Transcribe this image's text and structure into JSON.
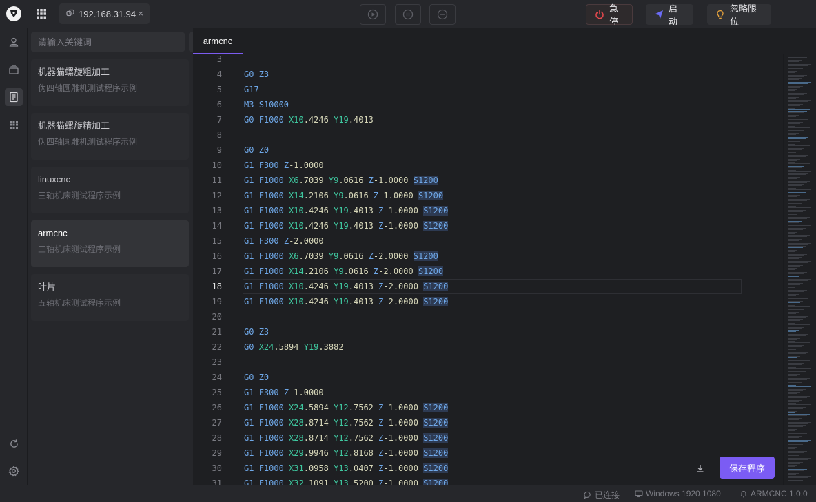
{
  "topbar": {
    "host": "192.168.31.94",
    "close_glyph": "×",
    "estop_label": "急停",
    "start_label": "启动",
    "ignore_limits_label": "忽略限位",
    "colors": {
      "estop": "#e5484d",
      "start": "#6b6cf6",
      "ignore": "#e8a33c"
    }
  },
  "sidebar": {
    "search_placeholder": "请输入关键词",
    "add_glyph": "+",
    "files": [
      {
        "name": "机器猫螺旋粗加工",
        "desc": "伪四轴圆雕机测试程序示例"
      },
      {
        "name": "机器猫螺旋精加工",
        "desc": "伪四轴圆雕机测试程序示例"
      },
      {
        "name": "linuxcnc",
        "desc": "三轴机床测试程序示例"
      },
      {
        "name": "armcnc",
        "desc": "三轴机床测试程序示例"
      },
      {
        "name": "叶片",
        "desc": "五轴机床测试程序示例"
      }
    ],
    "active_index": 3
  },
  "editor": {
    "tab": "armcnc",
    "current_line": "18",
    "save_label": "保存程序",
    "lines": [
      {
        "n": "3",
        "t": []
      },
      {
        "n": "4",
        "t": [
          [
            "g",
            "G0"
          ],
          [
            "sp",
            " "
          ],
          [
            "z",
            "Z3"
          ]
        ]
      },
      {
        "n": "5",
        "t": [
          [
            "g",
            "G17"
          ]
        ]
      },
      {
        "n": "6",
        "t": [
          [
            "g",
            "M3"
          ],
          [
            "sp",
            " "
          ],
          [
            "f",
            "S10000"
          ]
        ]
      },
      {
        "n": "7",
        "t": [
          [
            "g",
            "G0"
          ],
          [
            "sp",
            " "
          ],
          [
            "f",
            "F1000"
          ],
          [
            "sp",
            " "
          ],
          [
            "x",
            "X10"
          ],
          [
            "n",
            ".4246"
          ],
          [
            "sp",
            " "
          ],
          [
            "y",
            "Y19"
          ],
          [
            "n",
            ".4013"
          ]
        ]
      },
      {
        "n": "8",
        "t": []
      },
      {
        "n": "9",
        "t": [
          [
            "g",
            "G0"
          ],
          [
            "sp",
            " "
          ],
          [
            "z",
            "Z0"
          ]
        ]
      },
      {
        "n": "10",
        "t": [
          [
            "g",
            "G1"
          ],
          [
            "sp",
            " "
          ],
          [
            "f",
            "F300"
          ],
          [
            "sp",
            " "
          ],
          [
            "z",
            "Z"
          ],
          [
            "n",
            "-1.0000"
          ]
        ]
      },
      {
        "n": "11",
        "t": [
          [
            "g",
            "G1"
          ],
          [
            "sp",
            " "
          ],
          [
            "f",
            "F1000"
          ],
          [
            "sp",
            " "
          ],
          [
            "x",
            "X6"
          ],
          [
            "n",
            ".7039"
          ],
          [
            "sp",
            " "
          ],
          [
            "y",
            "Y9"
          ],
          [
            "n",
            ".0616"
          ],
          [
            "sp",
            " "
          ],
          [
            "z",
            "Z"
          ],
          [
            "n",
            "-1.0000"
          ],
          [
            "sp",
            " "
          ],
          [
            "s",
            "S1200"
          ]
        ]
      },
      {
        "n": "12",
        "t": [
          [
            "g",
            "G1"
          ],
          [
            "sp",
            " "
          ],
          [
            "f",
            "F1000"
          ],
          [
            "sp",
            " "
          ],
          [
            "x",
            "X14"
          ],
          [
            "n",
            ".2106"
          ],
          [
            "sp",
            " "
          ],
          [
            "y",
            "Y9"
          ],
          [
            "n",
            ".0616"
          ],
          [
            "sp",
            " "
          ],
          [
            "z",
            "Z"
          ],
          [
            "n",
            "-1.0000"
          ],
          [
            "sp",
            " "
          ],
          [
            "s",
            "S1200"
          ]
        ]
      },
      {
        "n": "13",
        "t": [
          [
            "g",
            "G1"
          ],
          [
            "sp",
            " "
          ],
          [
            "f",
            "F1000"
          ],
          [
            "sp",
            " "
          ],
          [
            "x",
            "X10"
          ],
          [
            "n",
            ".4246"
          ],
          [
            "sp",
            " "
          ],
          [
            "y",
            "Y19"
          ],
          [
            "n",
            ".4013"
          ],
          [
            "sp",
            " "
          ],
          [
            "z",
            "Z"
          ],
          [
            "n",
            "-1.0000"
          ],
          [
            "sp",
            " "
          ],
          [
            "s",
            "S1200"
          ]
        ]
      },
      {
        "n": "14",
        "t": [
          [
            "g",
            "G1"
          ],
          [
            "sp",
            " "
          ],
          [
            "f",
            "F1000"
          ],
          [
            "sp",
            " "
          ],
          [
            "x",
            "X10"
          ],
          [
            "n",
            ".4246"
          ],
          [
            "sp",
            " "
          ],
          [
            "y",
            "Y19"
          ],
          [
            "n",
            ".4013"
          ],
          [
            "sp",
            " "
          ],
          [
            "z",
            "Z"
          ],
          [
            "n",
            "-1.0000"
          ],
          [
            "sp",
            " "
          ],
          [
            "s",
            "S1200"
          ]
        ]
      },
      {
        "n": "15",
        "t": [
          [
            "g",
            "G1"
          ],
          [
            "sp",
            " "
          ],
          [
            "f",
            "F300"
          ],
          [
            "sp",
            " "
          ],
          [
            "z",
            "Z"
          ],
          [
            "n",
            "-2.0000"
          ]
        ]
      },
      {
        "n": "16",
        "t": [
          [
            "g",
            "G1"
          ],
          [
            "sp",
            " "
          ],
          [
            "f",
            "F1000"
          ],
          [
            "sp",
            " "
          ],
          [
            "x",
            "X6"
          ],
          [
            "n",
            ".7039"
          ],
          [
            "sp",
            " "
          ],
          [
            "y",
            "Y9"
          ],
          [
            "n",
            ".0616"
          ],
          [
            "sp",
            " "
          ],
          [
            "z",
            "Z"
          ],
          [
            "n",
            "-2.0000"
          ],
          [
            "sp",
            " "
          ],
          [
            "s",
            "S1200"
          ]
        ]
      },
      {
        "n": "17",
        "t": [
          [
            "g",
            "G1"
          ],
          [
            "sp",
            " "
          ],
          [
            "f",
            "F1000"
          ],
          [
            "sp",
            " "
          ],
          [
            "x",
            "X14"
          ],
          [
            "n",
            ".2106"
          ],
          [
            "sp",
            " "
          ],
          [
            "y",
            "Y9"
          ],
          [
            "n",
            ".0616"
          ],
          [
            "sp",
            " "
          ],
          [
            "z",
            "Z"
          ],
          [
            "n",
            "-2.0000"
          ],
          [
            "sp",
            " "
          ],
          [
            "s",
            "S1200"
          ]
        ]
      },
      {
        "n": "18",
        "t": [
          [
            "g",
            "G1"
          ],
          [
            "sp",
            " "
          ],
          [
            "f",
            "F1000"
          ],
          [
            "sp",
            " "
          ],
          [
            "x",
            "X10"
          ],
          [
            "n",
            ".4246"
          ],
          [
            "sp",
            " "
          ],
          [
            "y",
            "Y19"
          ],
          [
            "n",
            ".4013"
          ],
          [
            "sp",
            " "
          ],
          [
            "z",
            "Z"
          ],
          [
            "n",
            "-2.0000"
          ],
          [
            "sp",
            " "
          ],
          [
            "s",
            "S1200"
          ]
        ]
      },
      {
        "n": "19",
        "t": [
          [
            "g",
            "G1"
          ],
          [
            "sp",
            " "
          ],
          [
            "f",
            "F1000"
          ],
          [
            "sp",
            " "
          ],
          [
            "x",
            "X10"
          ],
          [
            "n",
            ".4246"
          ],
          [
            "sp",
            " "
          ],
          [
            "y",
            "Y19"
          ],
          [
            "n",
            ".4013"
          ],
          [
            "sp",
            " "
          ],
          [
            "z",
            "Z"
          ],
          [
            "n",
            "-2.0000"
          ],
          [
            "sp",
            " "
          ],
          [
            "s",
            "S1200"
          ]
        ]
      },
      {
        "n": "20",
        "t": []
      },
      {
        "n": "21",
        "t": [
          [
            "g",
            "G0"
          ],
          [
            "sp",
            " "
          ],
          [
            "z",
            "Z3"
          ]
        ]
      },
      {
        "n": "22",
        "t": [
          [
            "g",
            "G0"
          ],
          [
            "sp",
            " "
          ],
          [
            "x",
            "X24"
          ],
          [
            "n",
            ".5894"
          ],
          [
            "sp",
            " "
          ],
          [
            "y",
            "Y19"
          ],
          [
            "n",
            ".3882"
          ]
        ]
      },
      {
        "n": "23",
        "t": []
      },
      {
        "n": "24",
        "t": [
          [
            "g",
            "G0"
          ],
          [
            "sp",
            " "
          ],
          [
            "z",
            "Z0"
          ]
        ]
      },
      {
        "n": "25",
        "t": [
          [
            "g",
            "G1"
          ],
          [
            "sp",
            " "
          ],
          [
            "f",
            "F300"
          ],
          [
            "sp",
            " "
          ],
          [
            "z",
            "Z"
          ],
          [
            "n",
            "-1.0000"
          ]
        ]
      },
      {
        "n": "26",
        "t": [
          [
            "g",
            "G1"
          ],
          [
            "sp",
            " "
          ],
          [
            "f",
            "F1000"
          ],
          [
            "sp",
            " "
          ],
          [
            "x",
            "X24"
          ],
          [
            "n",
            ".5894"
          ],
          [
            "sp",
            " "
          ],
          [
            "y",
            "Y12"
          ],
          [
            "n",
            ".7562"
          ],
          [
            "sp",
            " "
          ],
          [
            "z",
            "Z"
          ],
          [
            "n",
            "-1.0000"
          ],
          [
            "sp",
            " "
          ],
          [
            "s",
            "S1200"
          ]
        ]
      },
      {
        "n": "27",
        "t": [
          [
            "g",
            "G1"
          ],
          [
            "sp",
            " "
          ],
          [
            "f",
            "F1000"
          ],
          [
            "sp",
            " "
          ],
          [
            "x",
            "X28"
          ],
          [
            "n",
            ".8714"
          ],
          [
            "sp",
            " "
          ],
          [
            "y",
            "Y12"
          ],
          [
            "n",
            ".7562"
          ],
          [
            "sp",
            " "
          ],
          [
            "z",
            "Z"
          ],
          [
            "n",
            "-1.0000"
          ],
          [
            "sp",
            " "
          ],
          [
            "s",
            "S1200"
          ]
        ]
      },
      {
        "n": "28",
        "t": [
          [
            "g",
            "G1"
          ],
          [
            "sp",
            " "
          ],
          [
            "f",
            "F1000"
          ],
          [
            "sp",
            " "
          ],
          [
            "x",
            "X28"
          ],
          [
            "n",
            ".8714"
          ],
          [
            "sp",
            " "
          ],
          [
            "y",
            "Y12"
          ],
          [
            "n",
            ".7562"
          ],
          [
            "sp",
            " "
          ],
          [
            "z",
            "Z"
          ],
          [
            "n",
            "-1.0000"
          ],
          [
            "sp",
            " "
          ],
          [
            "s",
            "S1200"
          ]
        ]
      },
      {
        "n": "29",
        "t": [
          [
            "g",
            "G1"
          ],
          [
            "sp",
            " "
          ],
          [
            "f",
            "F1000"
          ],
          [
            "sp",
            " "
          ],
          [
            "x",
            "X29"
          ],
          [
            "n",
            ".9946"
          ],
          [
            "sp",
            " "
          ],
          [
            "y",
            "Y12"
          ],
          [
            "n",
            ".8168"
          ],
          [
            "sp",
            " "
          ],
          [
            "z",
            "Z"
          ],
          [
            "n",
            "-1.0000"
          ],
          [
            "sp",
            " "
          ],
          [
            "s",
            "S1200"
          ]
        ]
      },
      {
        "n": "30",
        "t": [
          [
            "g",
            "G1"
          ],
          [
            "sp",
            " "
          ],
          [
            "f",
            "F1000"
          ],
          [
            "sp",
            " "
          ],
          [
            "x",
            "X31"
          ],
          [
            "n",
            ".0958"
          ],
          [
            "sp",
            " "
          ],
          [
            "y",
            "Y13"
          ],
          [
            "n",
            ".0407"
          ],
          [
            "sp",
            " "
          ],
          [
            "z",
            "Z"
          ],
          [
            "n",
            "-1.0000"
          ],
          [
            "sp",
            " "
          ],
          [
            "s",
            "S1200"
          ]
        ]
      },
      {
        "n": "31",
        "t": [
          [
            "g",
            "G1"
          ],
          [
            "sp",
            " "
          ],
          [
            "f",
            "F1000"
          ],
          [
            "sp",
            " "
          ],
          [
            "x",
            "X32"
          ],
          [
            "n",
            ".1091"
          ],
          [
            "sp",
            " "
          ],
          [
            "y",
            "Y13"
          ],
          [
            "n",
            ".5200"
          ],
          [
            "sp",
            " "
          ],
          [
            "z",
            "Z"
          ],
          [
            "n",
            "-1.0000"
          ],
          [
            "sp",
            " "
          ],
          [
            "s",
            "S1200"
          ]
        ]
      }
    ]
  },
  "statusbar": {
    "connection": "已连接",
    "platform": "Windows 1920 1080",
    "version": "ARMCNC 1.0.0"
  }
}
